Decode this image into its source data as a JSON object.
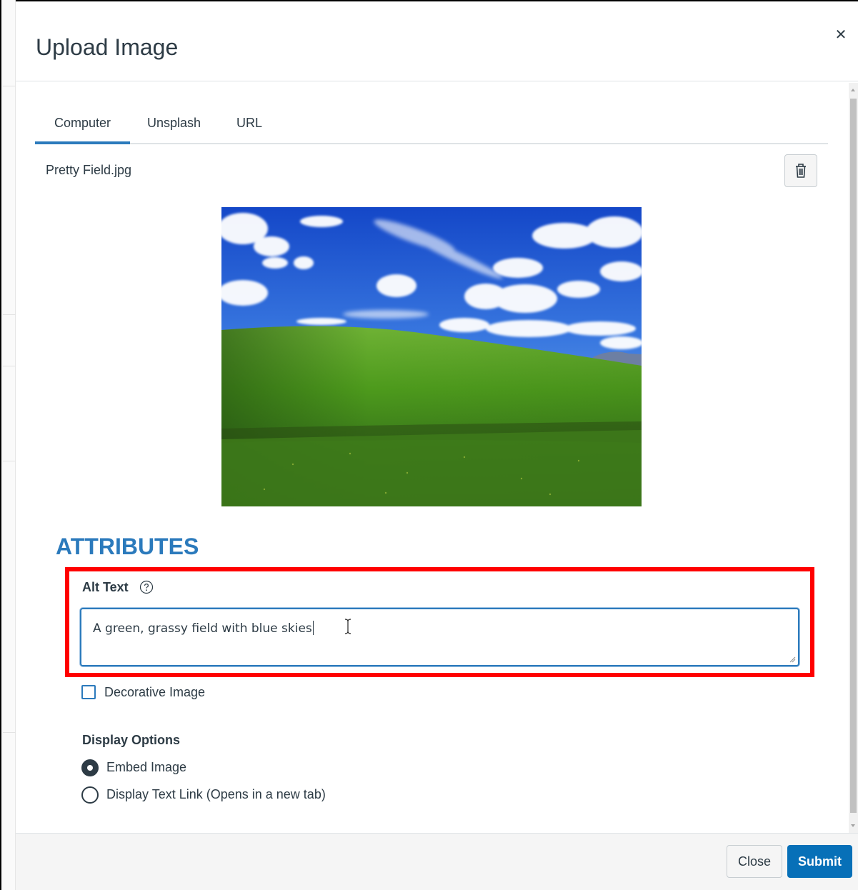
{
  "modal": {
    "title": "Upload Image",
    "close_icon": "close-icon"
  },
  "tabs": [
    {
      "label": "Computer",
      "active": true
    },
    {
      "label": "Unsplash",
      "active": false
    },
    {
      "label": "URL",
      "active": false
    }
  ],
  "file": {
    "name": "Pretty Field.jpg",
    "delete_icon": "trash-icon"
  },
  "attributes": {
    "heading": "ATTRIBUTES",
    "alt_text_label": "Alt Text",
    "alt_text_value": "A green, grassy field with blue skies",
    "help_icon": "help-icon",
    "decorative_label": "Decorative Image",
    "decorative_checked": false
  },
  "display_options": {
    "heading": "Display Options",
    "options": [
      {
        "label": "Embed Image",
        "selected": true
      },
      {
        "label": "Display Text Link (Opens in a new tab)",
        "selected": false
      }
    ]
  },
  "footer": {
    "close_label": "Close",
    "submit_label": "Submit"
  },
  "colors": {
    "accent": "#2b7abc",
    "submit": "#0770b8",
    "highlight": "#ff0000",
    "text": "#2d3b45"
  }
}
